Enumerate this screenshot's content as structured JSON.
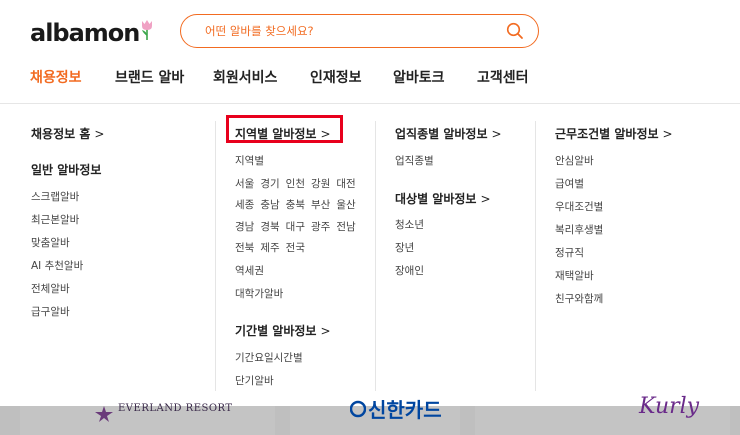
{
  "header": {
    "logo_text": "albamon",
    "search": {
      "placeholder": "어떤 알바를 찾으세요?"
    }
  },
  "gnb": {
    "items": [
      {
        "label": "채용정보",
        "active": true
      },
      {
        "label": "브랜드 알바",
        "active": false
      },
      {
        "label": "회원서비스",
        "active": false
      },
      {
        "label": "인재정보",
        "active": false
      },
      {
        "label": "알바토크",
        "active": false
      },
      {
        "label": "고객센터",
        "active": false
      }
    ]
  },
  "menu": {
    "col1": {
      "home": "채용정보 홈",
      "general_title": "일반 알바정보",
      "items": [
        "스크랩알바",
        "최근본알바",
        "맞춤알바",
        "AI 추천알바",
        "전체알바",
        "급구알바"
      ]
    },
    "col2": {
      "region_title": "지역별 알바정보",
      "region_all": "지역별",
      "regions": [
        [
          "서울",
          "경기",
          "인천",
          "강원",
          "대전"
        ],
        [
          "세종",
          "충남",
          "충북",
          "부산",
          "울산"
        ],
        [
          "경남",
          "경북",
          "대구",
          "광주",
          "전남"
        ],
        [
          "전북",
          "제주",
          "전국"
        ]
      ],
      "station": "역세권",
      "campus": "대학가알바",
      "period_title": "기간별 알바정보",
      "period_items": [
        "기간요일시간별",
        "단기알바"
      ]
    },
    "col3": {
      "job_title": "업직종별 알바정보",
      "job_all": "업직종별",
      "target_title": "대상별 알바정보",
      "target_items": [
        "청소년",
        "장년",
        "장애인"
      ]
    },
    "col4": {
      "cond_title": "근무조건별 알바정보",
      "cond_items": [
        "안심알바",
        "급여별",
        "우대조건별",
        "복리후생별",
        "정규직",
        "재택알바",
        "친구와함께"
      ]
    },
    "chevron": ">"
  },
  "bottom_cards": {
    "card1": "EVERLAND RESORT",
    "card2": "신한카드",
    "card3": "Kurly"
  },
  "colors": {
    "brand": "#f26b21",
    "highlight": "#e8001c"
  }
}
